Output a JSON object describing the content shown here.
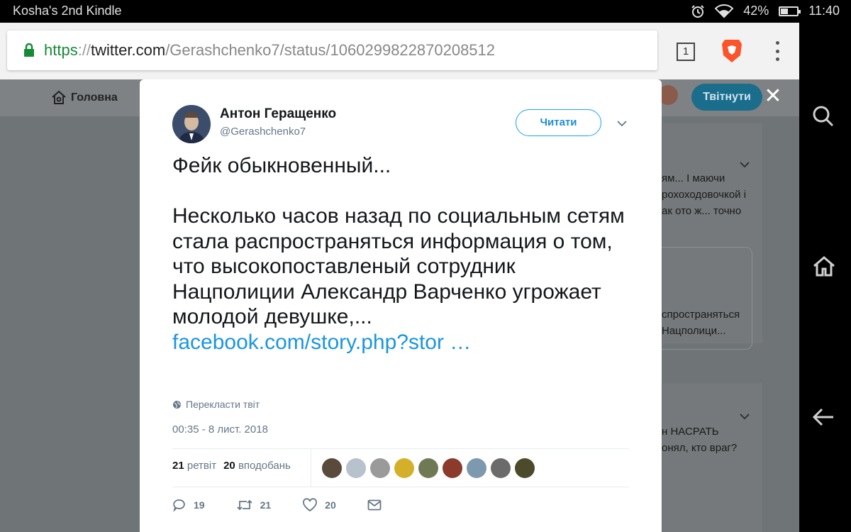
{
  "status_bar": {
    "device_name": "Kosha's 2nd Kindle",
    "battery": "42%",
    "battery_fraction": 0.42,
    "time": "11:40"
  },
  "browser": {
    "url_scheme": "https",
    "url_separator": "://",
    "url_host": "twitter.com",
    "url_path": "/Gerashchenko7/status/1060299822870208512",
    "tabs_count": "1"
  },
  "twitter_nav": {
    "home_label": "Головна",
    "tweet_button": "Твітнути",
    "close_label": "✕"
  },
  "background_tweets": {
    "card1_lines": [
      "ям... І маючи",
      "рохоходовочкой і",
      "ак ото ж... точно"
    ],
    "card1_quote_lines": [
      "спространяться",
      "Нацполици..."
    ],
    "card2_lines": [
      "н НАСРАТЬ",
      "онял, кто враг?"
    ]
  },
  "tweet": {
    "author_name": "Антон Геращенко",
    "author_handle": "@Gerashchenko7",
    "follow_label": "Читати",
    "text": "Фейк обыкновенный...\n\nНесколько часов назад по социальным сетям стала распространяться информация о том, что высокопоставленый  сотрудник Нацполиции Александр Варченко угрожает молодой девушке,...",
    "link": "facebook.com/story.php?stor …",
    "translate_label": "Перекласти твіт",
    "timestamp": "00:35 - 8 лист. 2018",
    "retweets_count": "21",
    "retweets_label": "ретвіт",
    "likes_count": "20",
    "likes_label": "вподобань",
    "reply_count": "19",
    "retweet_action_count": "21",
    "like_action_count": "20"
  },
  "colors": {
    "twitter_blue": "#1da1f2",
    "link_blue": "#1b95e0",
    "secure_green": "#168a38",
    "brave_orange": "#fb542b"
  },
  "liker_colors": [
    "#5a4a3c",
    "#b8c2cc",
    "#9a9a9a",
    "#d4b02a",
    "#6f7a55",
    "#8a3b2b",
    "#7d99b0",
    "#6b6b6b",
    "#4b4a2a"
  ]
}
